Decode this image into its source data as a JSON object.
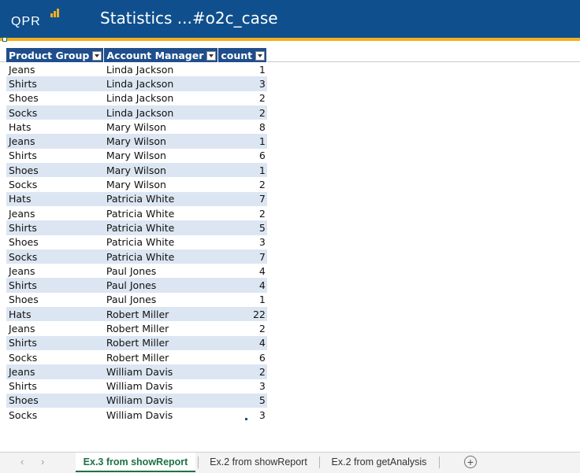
{
  "header": {
    "logo_text": "QPR",
    "title": "Statistics ...#o2c_case"
  },
  "table": {
    "columns": [
      "Product Group",
      "Account Manager",
      "count"
    ],
    "rows": [
      [
        "Jeans",
        "Linda Jackson",
        "1"
      ],
      [
        "Shirts",
        "Linda Jackson",
        "3"
      ],
      [
        "Shoes",
        "Linda Jackson",
        "2"
      ],
      [
        "Socks",
        "Linda Jackson",
        "2"
      ],
      [
        "Hats",
        "Mary Wilson",
        "8"
      ],
      [
        "Jeans",
        "Mary Wilson",
        "1"
      ],
      [
        "Shirts",
        "Mary Wilson",
        "6"
      ],
      [
        "Shoes",
        "Mary Wilson",
        "1"
      ],
      [
        "Socks",
        "Mary Wilson",
        "2"
      ],
      [
        "Hats",
        "Patricia White",
        "7"
      ],
      [
        "Jeans",
        "Patricia White",
        "2"
      ],
      [
        "Shirts",
        "Patricia White",
        "5"
      ],
      [
        "Shoes",
        "Patricia White",
        "3"
      ],
      [
        "Socks",
        "Patricia White",
        "7"
      ],
      [
        "Jeans",
        "Paul Jones",
        "4"
      ],
      [
        "Shirts",
        "Paul Jones",
        "4"
      ],
      [
        "Shoes",
        "Paul Jones",
        "1"
      ],
      [
        "Hats",
        "Robert Miller",
        "22"
      ],
      [
        "Jeans",
        "Robert Miller",
        "2"
      ],
      [
        "Shirts",
        "Robert Miller",
        "4"
      ],
      [
        "Socks",
        "Robert Miller",
        "6"
      ],
      [
        "Jeans",
        "William Davis",
        "2"
      ],
      [
        "Shirts",
        "William Davis",
        "3"
      ],
      [
        "Shoes",
        "William Davis",
        "5"
      ],
      [
        "Socks",
        "William Davis",
        "3"
      ]
    ]
  },
  "sheet_tabs": [
    {
      "label": "Ex.3 from showReport",
      "active": true
    },
    {
      "label": "Ex.2 from showReport",
      "active": false
    },
    {
      "label": "Ex.2 from getAnalysis",
      "active": false
    }
  ],
  "icons": {
    "prev": "chevron-left-icon",
    "next": "chevron-right-icon",
    "add": "plus-circle-icon"
  },
  "colors": {
    "header_bg": "#0f4f8d",
    "accent": "#f2b01e",
    "table_header": "#1f4e8c",
    "row_band": "#dce6f2",
    "active_tab": "#1e7145"
  }
}
